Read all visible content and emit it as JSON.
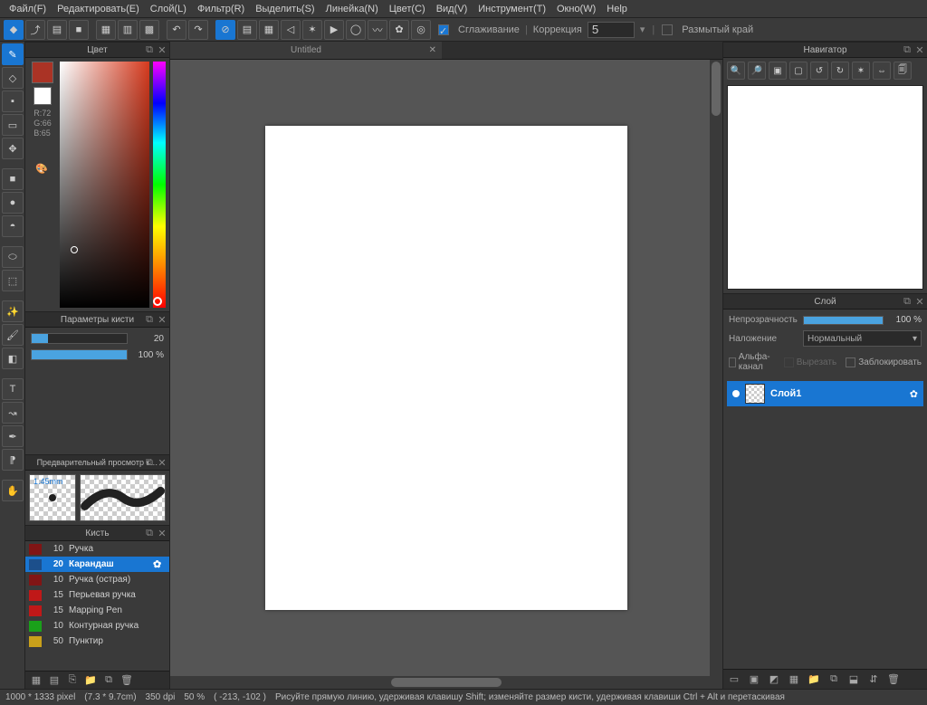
{
  "menu": [
    "Файл(F)",
    "Редактировать(E)",
    "Слой(L)",
    "Фильтр(R)",
    "Выделить(S)",
    "Линейка(N)",
    "Цвет(C)",
    "Вид(V)",
    "Инструмент(T)",
    "Окно(W)",
    "Help"
  ],
  "toolbar": {
    "smoothing_label": "Сглаживание",
    "correction_label": "Коррекция",
    "correction_value": "5",
    "blur_edge_label": "Размытый край"
  },
  "tab": {
    "title": "Untitled"
  },
  "color_panel": {
    "title": "Цвет",
    "fg": "#aa3325",
    "bg": "#ffffff",
    "r": "R:72",
    "g": "G:66",
    "b": "B:65"
  },
  "brush_params": {
    "title": "Параметры кисти",
    "size_val": "20",
    "size_pct": 17,
    "opacity_val": "100 %",
    "opacity_pct": 100
  },
  "brush_preview": {
    "title": "Предварительный просмотр к…",
    "label": "1.45mm"
  },
  "brush_panel": {
    "title": "Кисть",
    "brushes": [
      {
        "color": "#801515",
        "size": "10",
        "name": "Ручка",
        "selected": false
      },
      {
        "color": "#1c4f8b",
        "size": "20",
        "name": "Карандаш",
        "selected": true
      },
      {
        "color": "#801515",
        "size": "10",
        "name": "Ручка (острая)",
        "selected": false
      },
      {
        "color": "#c01818",
        "size": "15",
        "name": "Перьевая ручка",
        "selected": false
      },
      {
        "color": "#c01818",
        "size": "15",
        "name": "Mapping Pen",
        "selected": false
      },
      {
        "color": "#1aa01a",
        "size": "10",
        "name": "Контурная ручка",
        "selected": false
      },
      {
        "color": "#c9a01a",
        "size": "50",
        "name": "Пунктир",
        "selected": false
      }
    ]
  },
  "navigator": {
    "title": "Навигатор"
  },
  "layer_panel": {
    "title": "Слой",
    "opacity_label": "Непрозрачность",
    "opacity_val": "100 %",
    "blend_label": "Наложение",
    "blend_value": "Нормальный",
    "alpha_label": "Альфа-канал",
    "cut_label": "Вырезать",
    "lock_label": "Заблокировать",
    "layers": [
      {
        "name": "Слой1"
      }
    ]
  },
  "status": {
    "dims": "1000 * 1333 pixel",
    "phys": "(7.3 * 9.7cm)",
    "dpi": "350 dpi",
    "zoom": "50 %",
    "coords": "( -213, -102 )",
    "hint": "Рисуйте прямую линию, удерживая клавишу Shift; изменяйте размер кисти, удерживая клавиши Ctrl + Alt и перетаскивая"
  }
}
